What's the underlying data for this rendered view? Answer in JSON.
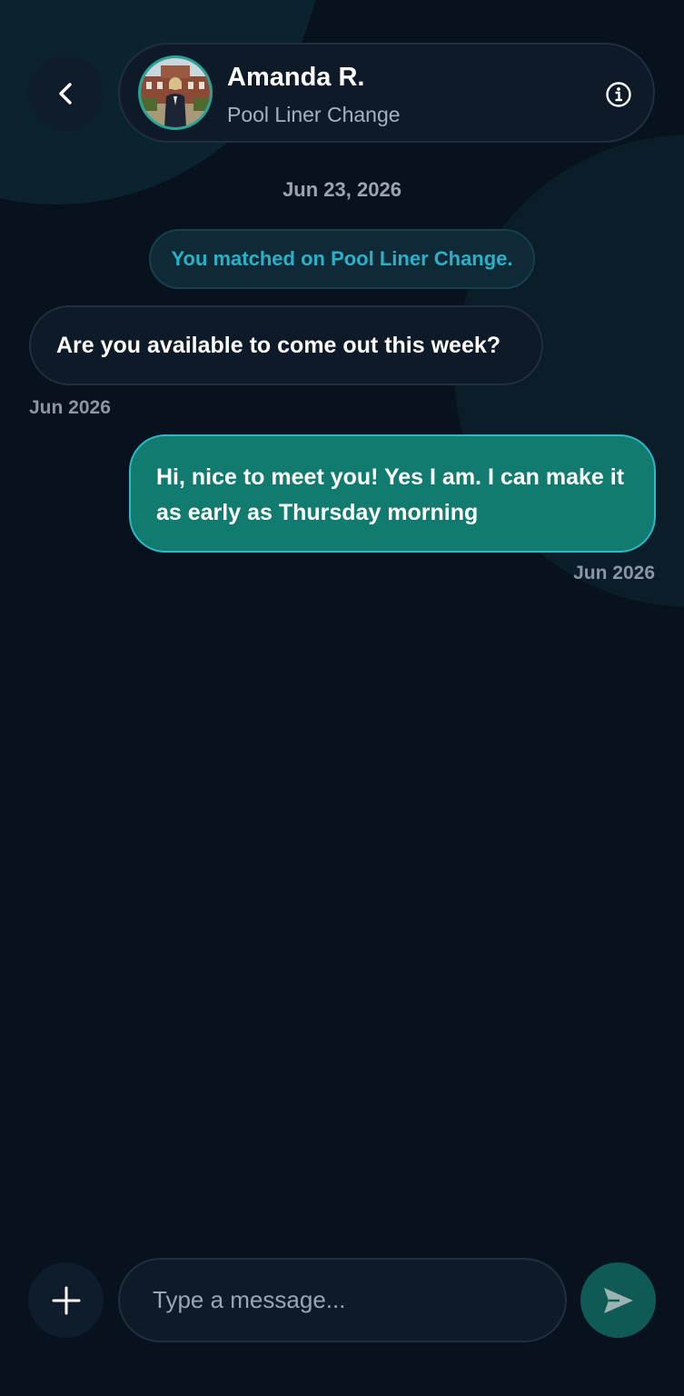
{
  "header": {
    "contact_name": "Amanda R.",
    "contact_subtitle": "Pool Liner Change",
    "avatar_alt": "Amanda R."
  },
  "chat": {
    "date_separator": "Jun 23, 2026",
    "system_message": "You matched on Pool Liner Change.",
    "messages": [
      {
        "direction": "incoming",
        "text": "Are you available to come out this week?",
        "time": "Jun 2026"
      },
      {
        "direction": "outgoing",
        "text": "Hi, nice to meet you! Yes I am. I can make it as early as Thursday morning",
        "time": "Jun 2026"
      }
    ]
  },
  "composer": {
    "placeholder": "Type a message..."
  },
  "colors": {
    "background": "#08111e",
    "accent": "#127b70",
    "accent_border": "#2fb8c6",
    "system_text": "#27b2c8"
  }
}
